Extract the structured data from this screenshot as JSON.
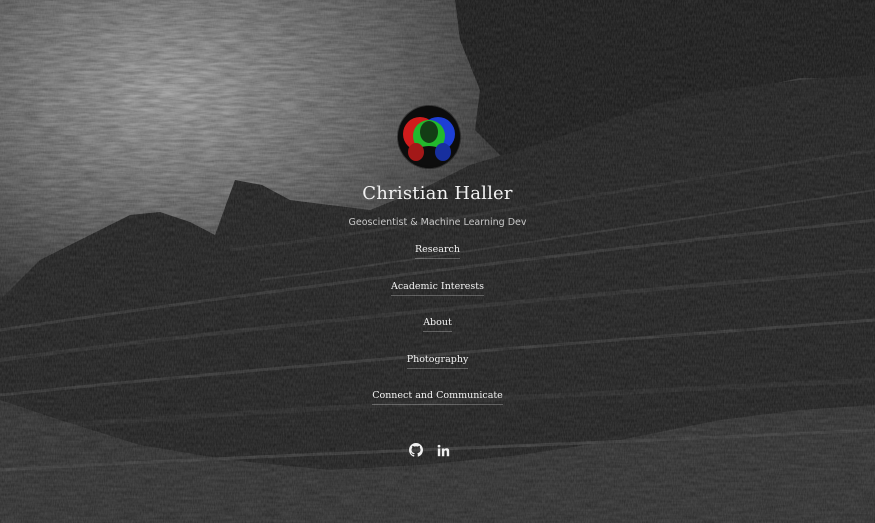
{
  "profile": {
    "name": "Christian Haller",
    "tagline": "Geoscientist & Machine Learning Dev"
  },
  "nav": {
    "items": [
      {
        "label": "Research"
      },
      {
        "label": "Academic Interests"
      },
      {
        "label": "About"
      },
      {
        "label": "Photography"
      },
      {
        "label": "Connect and Communicate"
      }
    ]
  },
  "social": {
    "icons": [
      "github-icon",
      "linkedin-icon"
    ]
  },
  "colors": {
    "text": "#f2f2f2",
    "muted": "#c8c8c8"
  }
}
